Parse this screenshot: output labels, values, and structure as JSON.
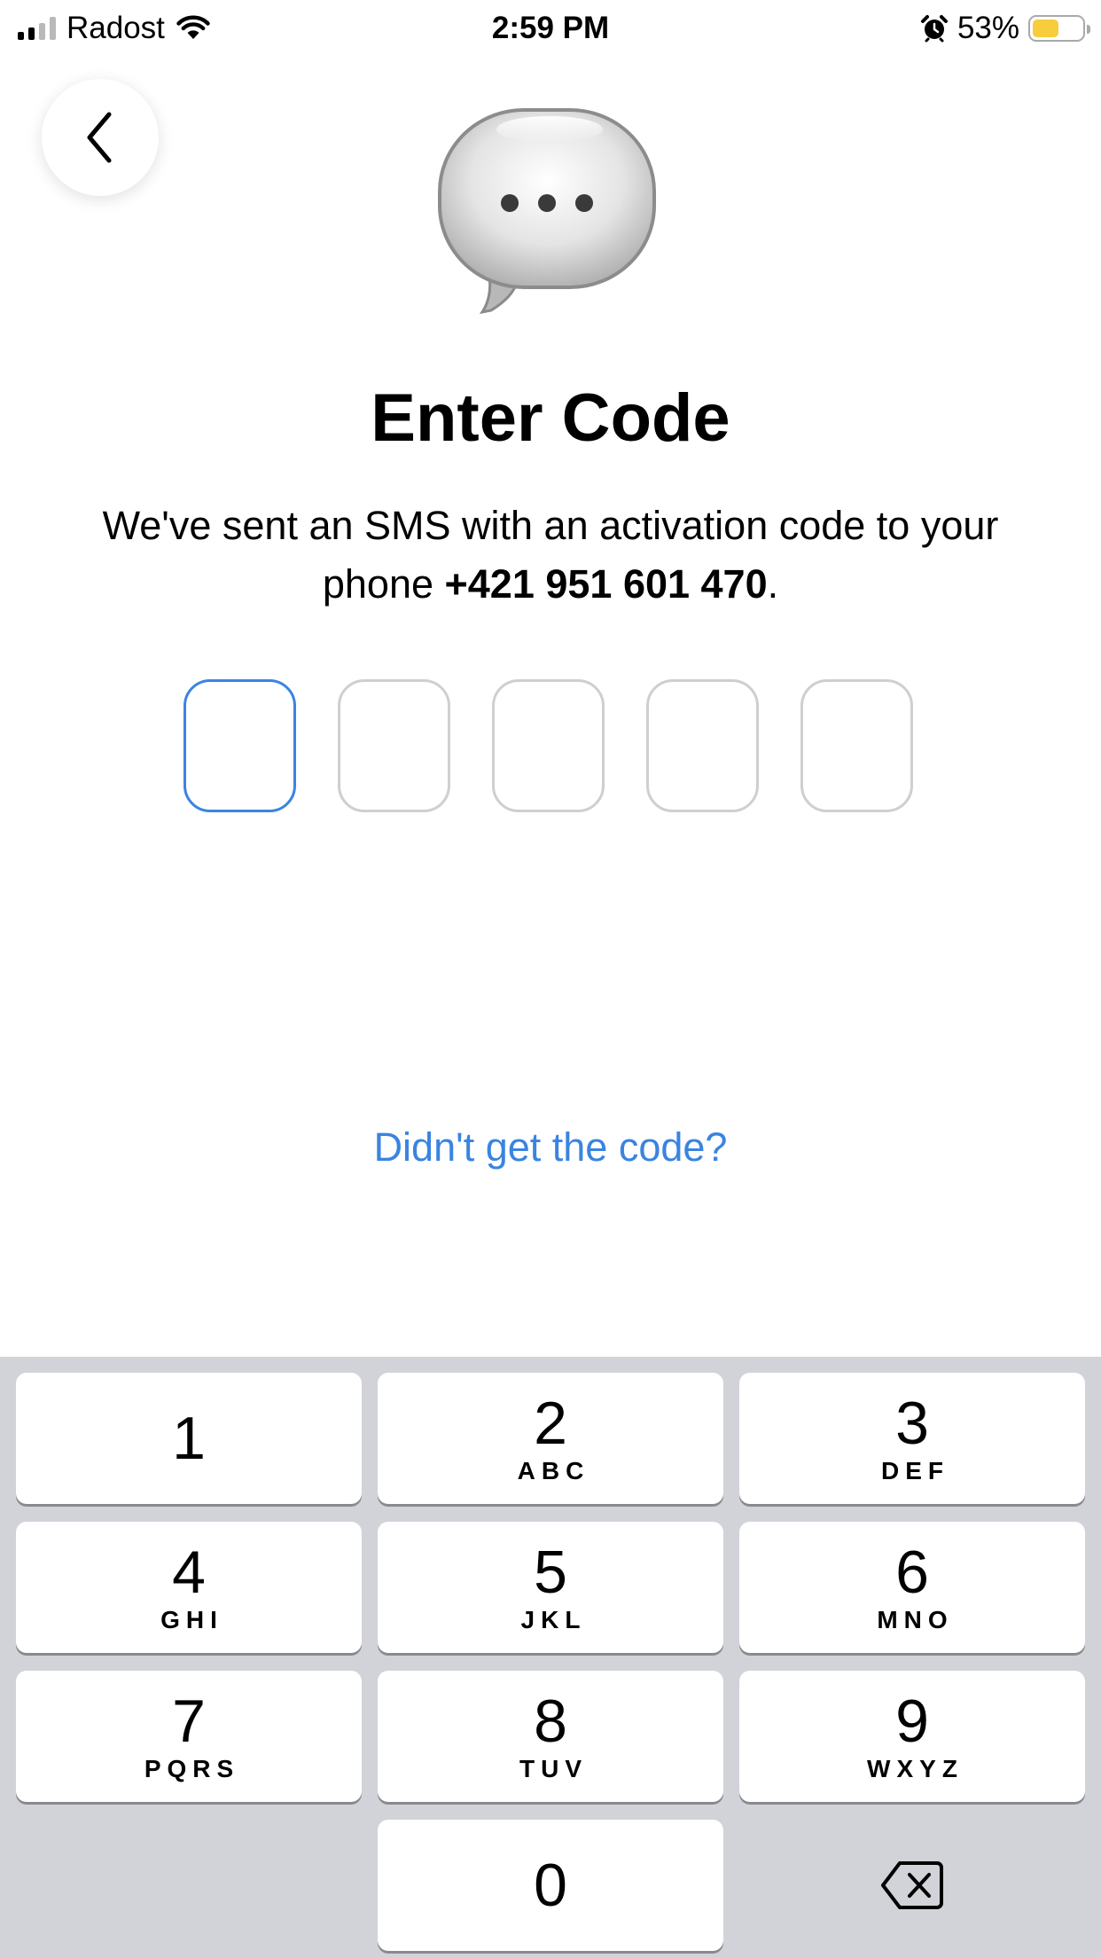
{
  "status_bar": {
    "carrier": "Radost",
    "time": "2:59 PM",
    "battery_percent": "53%",
    "battery_level": 0.53,
    "icons": [
      "signal-icon",
      "wifi-icon",
      "alarm-icon",
      "battery-icon"
    ]
  },
  "header": {
    "back_icon": "chevron-left-icon",
    "illustration": "speech-bubble-icon"
  },
  "title": "Enter Code",
  "subtitle": {
    "text": "We've sent an SMS with an activation code to your phone ",
    "phone": "+421 951 601 470",
    "suffix": "."
  },
  "code": {
    "length": 5,
    "digits": [
      "",
      "",
      "",
      "",
      ""
    ],
    "active_index": 0,
    "active_color": "#3b84e0"
  },
  "resend_link": "Didn't get the code?",
  "keypad": {
    "keys": [
      {
        "num": "1",
        "letters": ""
      },
      {
        "num": "2",
        "letters": "ABC"
      },
      {
        "num": "3",
        "letters": "DEF"
      },
      {
        "num": "4",
        "letters": "GHI"
      },
      {
        "num": "5",
        "letters": "JKL"
      },
      {
        "num": "6",
        "letters": "MNO"
      },
      {
        "num": "7",
        "letters": "PQRS"
      },
      {
        "num": "8",
        "letters": "TUV"
      },
      {
        "num": "9",
        "letters": "WXYZ"
      },
      {
        "num": "0",
        "letters": ""
      }
    ],
    "delete_icon": "backspace-icon"
  },
  "colors": {
    "link": "#3a84e0",
    "keypad_bg": "#d1d3d9",
    "battery": "#f7cc3d"
  }
}
